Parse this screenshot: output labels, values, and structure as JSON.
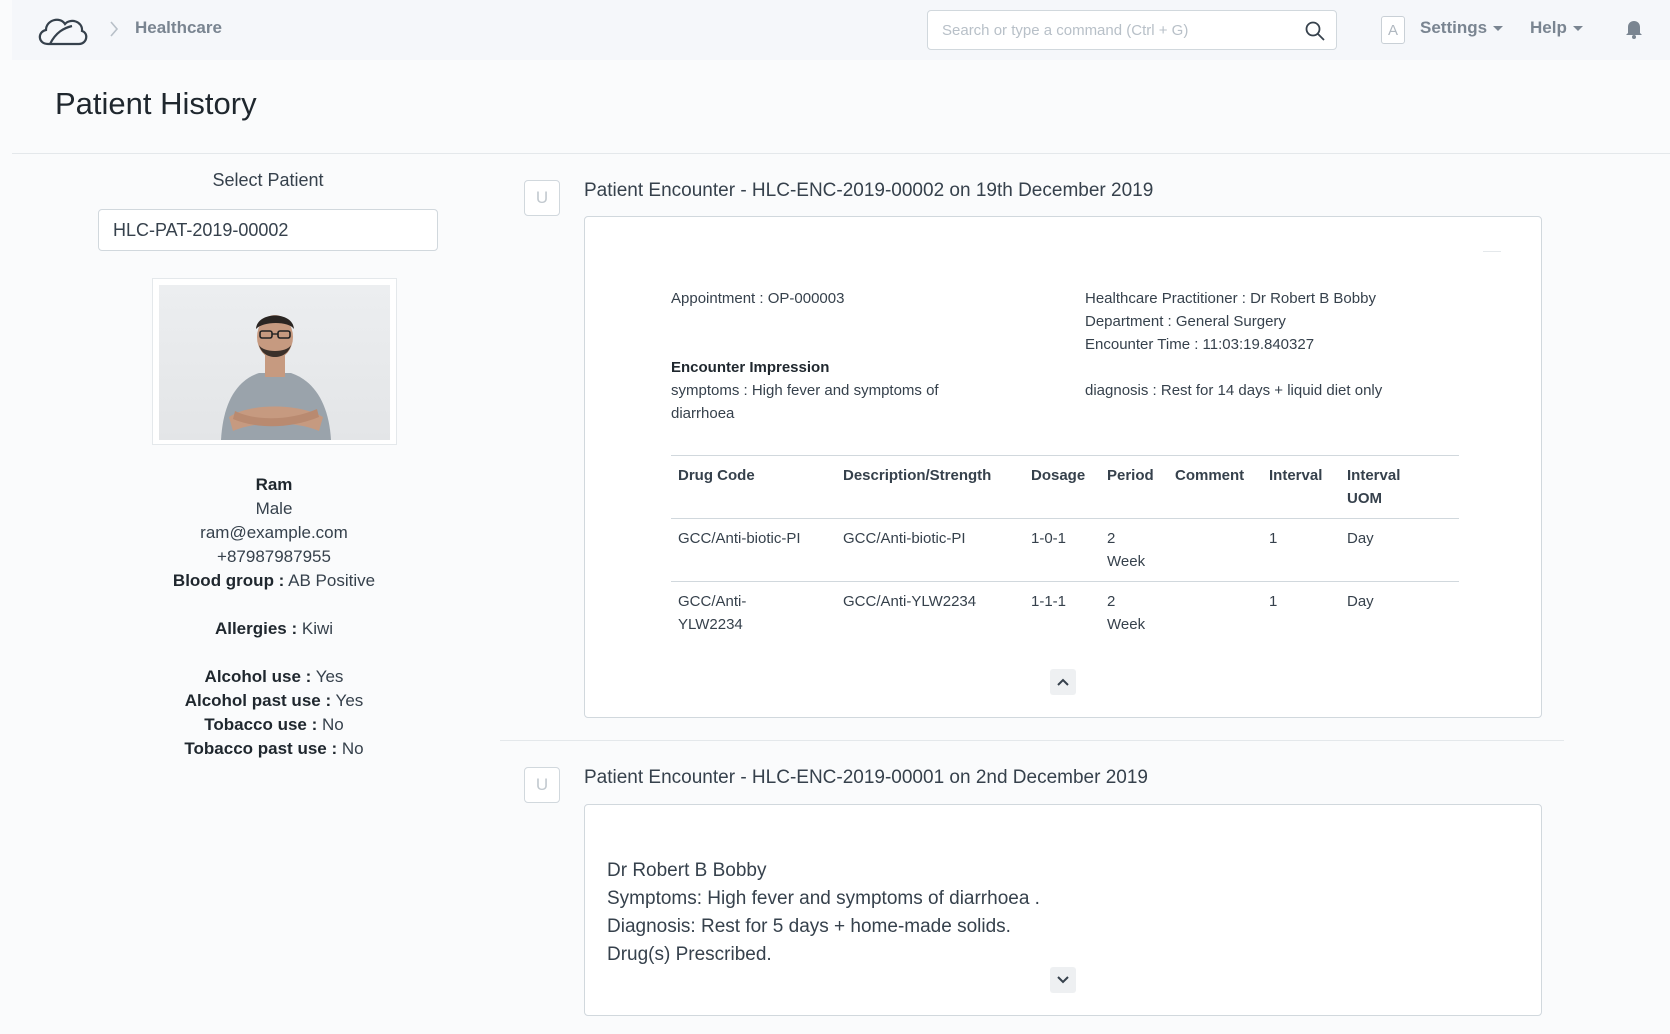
{
  "navbar": {
    "breadcrumb": "Healthcare",
    "search_placeholder": "Search or type a command (Ctrl + G)",
    "avatar_letter": "A",
    "settings_label": "Settings",
    "help_label": "Help"
  },
  "page": {
    "title": "Patient History"
  },
  "sidebar": {
    "select_label": "Select Patient",
    "patient_id": "HLC-PAT-2019-00002",
    "name": "Ram",
    "gender": "Male",
    "email": "ram@example.com",
    "phone": "+87987987955",
    "blood_group_label": "Blood group :",
    "blood_group": "AB Positive",
    "allergies_label": "Allergies :",
    "allergies": "Kiwi",
    "alcohol_use_label": "Alcohol use :",
    "alcohol_use": "Yes",
    "alcohol_past_label": "Alcohol past use :",
    "alcohol_past": "Yes",
    "tobacco_use_label": "Tobacco use :",
    "tobacco_use": "No",
    "tobacco_past_label": "Tobacco past use :",
    "tobacco_past": "No"
  },
  "encounters": [
    {
      "badge": "U",
      "title": "Patient Encounter - HLC-ENC-2019-00002 on 19th December 2019",
      "appointment": "Appointment : OP-000003",
      "practitioner": "Healthcare Practitioner : Dr Robert B Bobby",
      "department": "Department : General Surgery",
      "encounter_time": "Encounter Time : 11:03:19.840327",
      "impression_label": "Encounter Impression",
      "symptoms_line1": "symptoms : High fever and symptoms of",
      "symptoms_line2": "diarrhoea",
      "diagnosis": "diagnosis : Rest for 14 days + liquid diet only",
      "table": {
        "headers": [
          "Drug Code",
          "Description/Strength",
          "Dosage",
          "Period",
          "Comment",
          "Interval",
          "Interval",
          "UOM"
        ],
        "rows": [
          [
            "GCC/Anti-biotic-PI",
            "GCC/Anti-biotic-PI",
            "1-0-1",
            "2",
            "Week",
            "",
            "1",
            "Day"
          ],
          [
            "GCC/Anti-",
            "YLW2234",
            "GCC/Anti-YLW2234",
            "1-1-1",
            "2",
            "Week",
            "",
            "1",
            "Day"
          ]
        ]
      }
    },
    {
      "badge": "U",
      "title": "Patient Encounter - HLC-ENC-2019-00001 on 2nd December 2019",
      "line1": "Dr Robert B Bobby",
      "line2": "Symptoms: High fever and symptoms of diarrhoea .",
      "line3": "Diagnosis: Rest for 5 days + home-made solids.",
      "line4": "Drug(s) Prescribed."
    }
  ],
  "colors": {
    "navbar_bg": "#f5f7fa",
    "text": "#36414c",
    "border": "#d1d8dd"
  }
}
